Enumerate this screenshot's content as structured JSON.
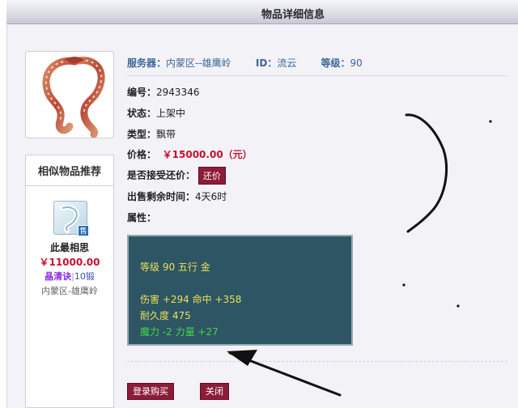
{
  "header": {
    "title": "物品详细信息"
  },
  "item": {
    "image_icon": "scarf-ribbon-icon",
    "server_label": "服务器：",
    "server_value": "内蒙区--雄鹰岭",
    "id_label": "ID：",
    "id_value": "流云",
    "level_label": "等级：",
    "level_value": "90",
    "number_label": "编号：",
    "number_value": "2943346",
    "status_label": "状态：",
    "status_value": "上架中",
    "type_label": "类型：",
    "type_value": "飘带",
    "price_label": "价格：",
    "price_value": "￥15000.00（元）",
    "bargain_label": "是否接受还价：",
    "bargain_button": "还价",
    "remaining_label": "出售剩余时间：",
    "remaining_value": "4天6时",
    "attributes_label": "属性："
  },
  "attributes": {
    "line1": "等级 90 五行 金",
    "line2": "伤害 +294 命中 +358",
    "line3": "耐久度 475",
    "line4": "魔力 -2 力量 +27"
  },
  "sidebar": {
    "title": "相似物品推荐",
    "items": [
      {
        "icon": "sale-item-icon",
        "badge": "售",
        "name": "此最相思",
        "price": "￥11000.00",
        "tag1": "晶清诀",
        "separator": "|",
        "tag2": "10锻",
        "server": "内蒙区-雄鹰岭"
      }
    ]
  },
  "actions": {
    "login_buy": "登录购买",
    "close": "关闭"
  },
  "colors": {
    "accent": "#8c1c3a",
    "price": "#c8102e",
    "attr_bg": "#2e5564",
    "attr_yellow": "#e8e05a",
    "attr_green": "#43d944"
  }
}
